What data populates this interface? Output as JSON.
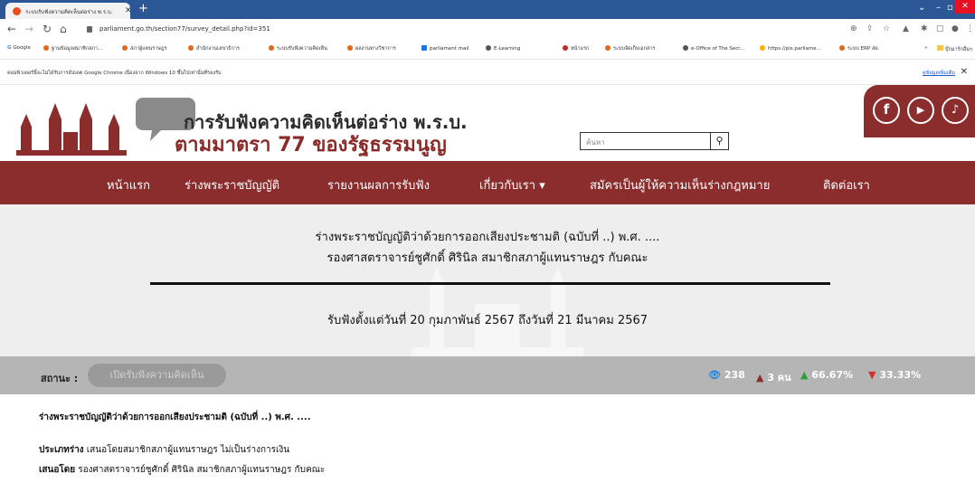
{
  "browser": {
    "tab_title": "ระบบรับฟังความคิดเห็นต่อร่าง พ.ร.บ.",
    "url": "parliament.go.th/section77/survey_detail.php?id=351",
    "bookmarks": [
      "Google",
      "ฐานข้อมูลสมาชิกสภา...",
      "สภาผู้แทนราษฎร",
      "สำนักงานเลขาธิการ",
      "ระบบรับฟังความคิดเห็น",
      "ผลงานทางวิชาการ",
      "parliament mail",
      "E-Learning",
      "หน้าแรก",
      "ระบบจัดเก็บเอกสาร",
      "e-Office of The Secr...",
      "https://pis.parliame...",
      "ระบบ ERP สผ."
    ],
    "bookmarks_more": "»",
    "bookmarks_folder": "บุ๊กมาร์กอื่นๆ",
    "infobar_text": "คอมพิวเตอร์นี้จะไม่ได้รับการอัปเดต Google Chrome เนื่องจาก Windows 10 ขึ้นไปเท่านั้นที่รองรับ",
    "infobar_link": "ดูข้อมูลเพิ่มเติม"
  },
  "site": {
    "title_line1": "การรับฟังความคิดเห็นต่อร่าง พ.ร.บ.",
    "title_line2": "ตามมาตรา 77 ของรัฐธรรมนูญ",
    "search_placeholder": "ค้นหา",
    "social": [
      "f",
      "▶",
      "♪"
    ]
  },
  "nav": [
    "หน้าแรก",
    "ร่างพระราชบัญญัติ",
    "รายงานผลการรับฟัง",
    "เกี่ยวกับเรา ▾",
    "สมัครเป็นผู้ให้ความเห็นร่างกฎหมาย",
    "ติดต่อเรา"
  ],
  "hero": {
    "line1": "ร่างพระราชบัญญัติว่าด้วยการออกเสียงประชามติ (ฉบับที่ ..) พ.ศ. ....",
    "line2": "รองศาสตราจารย์ชูศักดิ์ ศิรินิล สมาชิกสภาผู้แทนราษฎร กับคณะ",
    "dates": "รับฟังตั้งแต่วันที่ 20 กุมภาพันธ์ 2567 ถึงวันที่ 21 มีนาคม 2567"
  },
  "status": {
    "label": "สถานะ :",
    "value": "เปิดรับฟังความคิดเห็น",
    "views": "238",
    "people": "3 คน",
    "like_pct": "66.67%",
    "dislike_pct": "33.33%"
  },
  "content": {
    "title": "ร่างพระราชบัญญัติว่าด้วยการออกเสียงประชามติ (ฉบับที่ ..) พ.ศ. ....",
    "type_label": "ประเภทร่าง",
    "type_value": "เสนอโดยสมาชิกสภาผู้แทนราษฎร ไม่เป็นร่างการเงิน",
    "proposer_label": "เสนอโดย",
    "proposer_value": "รองศาสตราจารย์ชูศักดิ์ ศิรินิล สมาชิกสภาผู้แทนราษฎร กับคณะ"
  }
}
